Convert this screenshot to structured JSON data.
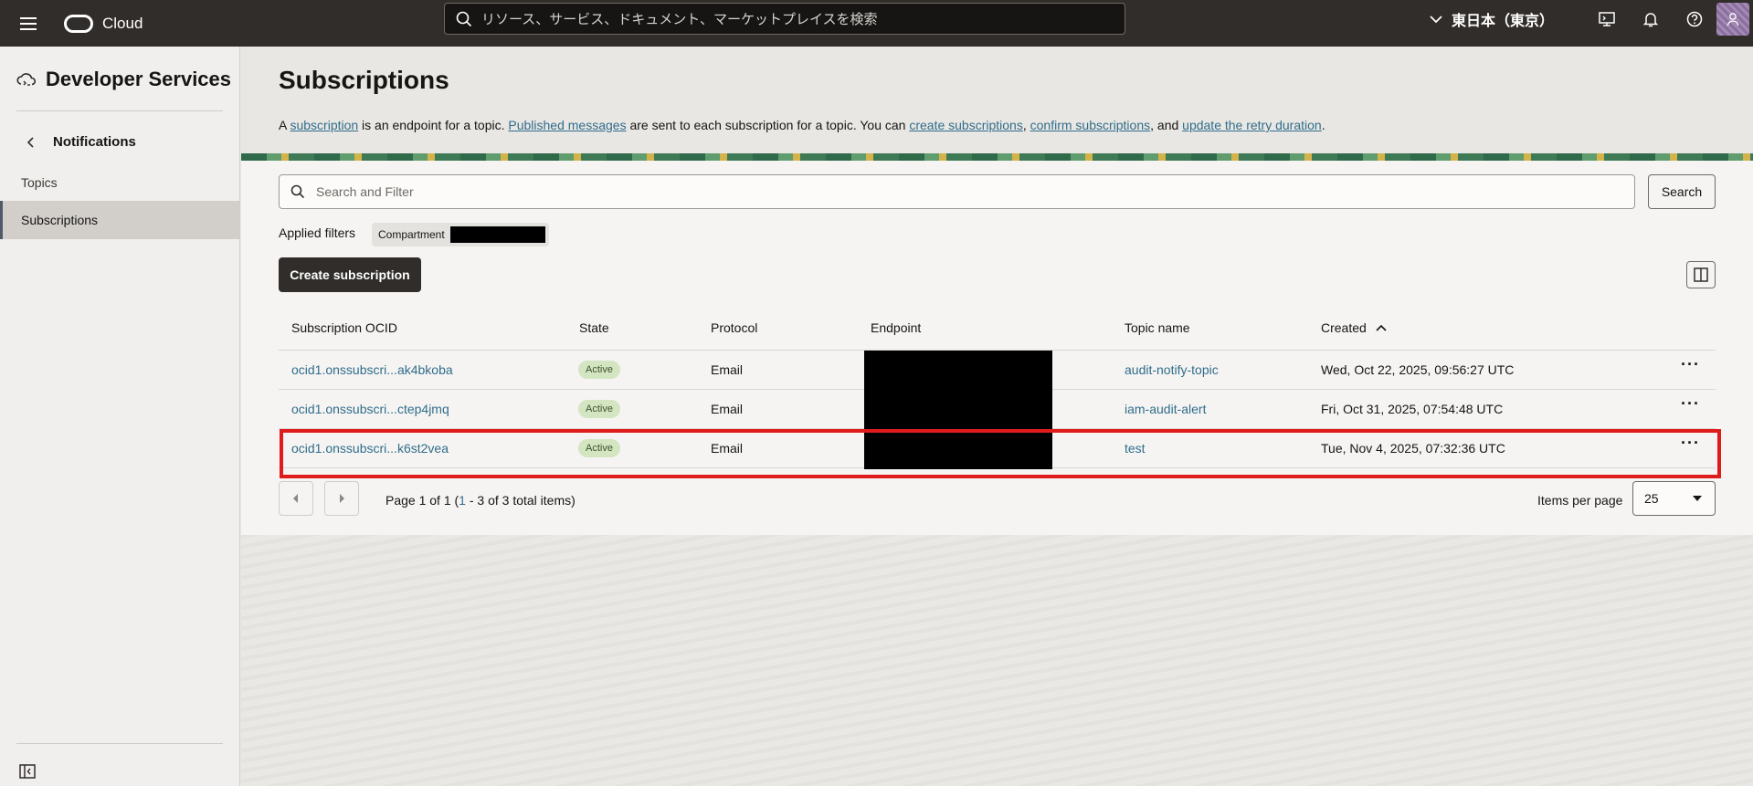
{
  "topbar": {
    "brand": "Cloud",
    "search_placeholder": "リソース、サービス、ドキュメント、マーケットプレイスを検索",
    "region": "東日本（東京）"
  },
  "sidebar": {
    "title": "Developer Services",
    "back_label": "Notifications",
    "items": [
      {
        "label": "Topics"
      },
      {
        "label": "Subscriptions"
      }
    ]
  },
  "page": {
    "title": "Subscriptions",
    "desc": {
      "t1": "A ",
      "link1": "subscription",
      "t2": " is an endpoint for a topic. ",
      "link2": "Published messages",
      "t3": " are sent to each subscription for a topic. You can ",
      "link3": "create subscriptions",
      "t4": ", ",
      "link4": "confirm subscriptions",
      "t5": ", and ",
      "link5": "update the retry duration",
      "t6": "."
    }
  },
  "filter": {
    "placeholder": "Search and Filter",
    "search_button": "Search",
    "applied_label": "Applied filters",
    "chip_label": "Compartment"
  },
  "actions": {
    "create_label": "Create subscription"
  },
  "table": {
    "headers": [
      "Subscription OCID",
      "State",
      "Protocol",
      "Endpoint",
      "Topic name",
      "Created"
    ],
    "rows": [
      {
        "ocid": "ocid1.onssubscri...ak4bkoba",
        "state": "Active",
        "protocol": "Email",
        "topic": "audit-notify-topic",
        "created": "Wed, Oct 22, 2025, 09:56:27 UTC"
      },
      {
        "ocid": "ocid1.onssubscri...ctep4jmq",
        "state": "Active",
        "protocol": "Email",
        "topic": "iam-audit-alert",
        "created": "Fri, Oct 31, 2025, 07:54:48 UTC"
      },
      {
        "ocid": "ocid1.onssubscri...k6st2vea",
        "state": "Active",
        "protocol": "Email",
        "topic": "test",
        "created": "Tue, Nov 4, 2025, 07:32:36 UTC"
      }
    ]
  },
  "pagination": {
    "t1": "Page 1 of 1 (",
    "range_start": "1",
    "t2": " - 3 of 3 total items)",
    "ipp_label": "Items per page",
    "ipp_value": "25"
  }
}
